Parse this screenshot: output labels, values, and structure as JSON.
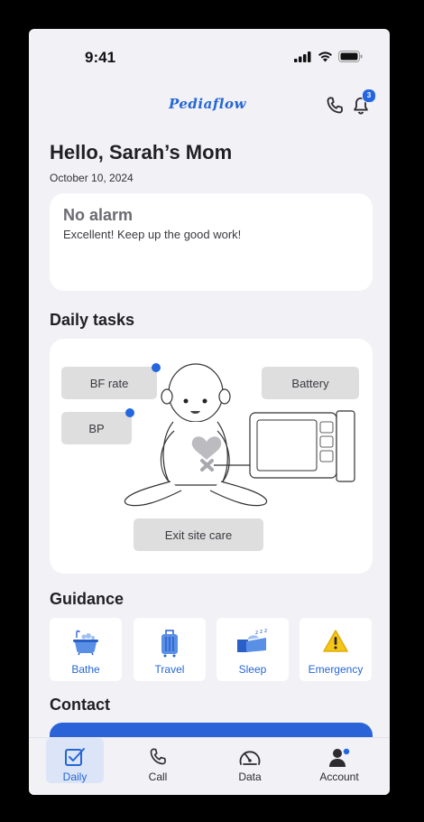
{
  "status": {
    "time": "9:41"
  },
  "header": {
    "logo": "Pediaflow",
    "notification_count": "3"
  },
  "greeting": {
    "title": "Hello, Sarah’s Mom",
    "date": "October 10, 2024"
  },
  "alarm": {
    "title": "No alarm",
    "message": "Excellent! Keep up the good work!"
  },
  "daily_tasks": {
    "title": "Daily tasks",
    "buttons": {
      "bf_rate": "BF rate",
      "battery": "Battery",
      "bp": "BP",
      "exit_site": "Exit site care"
    }
  },
  "guidance": {
    "title": "Guidance",
    "items": [
      {
        "label": "Bathe",
        "icon": "bathtub-icon"
      },
      {
        "label": "Travel",
        "icon": "suitcase-icon"
      },
      {
        "label": "Sleep",
        "icon": "bed-icon"
      },
      {
        "label": "Emergency",
        "icon": "warning-icon"
      }
    ]
  },
  "contact": {
    "title": "Contact"
  },
  "nav": {
    "items": [
      {
        "label": "Daily",
        "icon": "checkbox-icon",
        "active": true
      },
      {
        "label": "Call",
        "icon": "phone-icon"
      },
      {
        "label": "Data",
        "icon": "gauge-icon"
      },
      {
        "label": "Account",
        "icon": "user-icon"
      }
    ]
  },
  "colors": {
    "accent": "#2566d6",
    "badge": "#2466e0",
    "background": "#f1f1f6",
    "card": "#ffffff",
    "task_button": "#dededf"
  }
}
